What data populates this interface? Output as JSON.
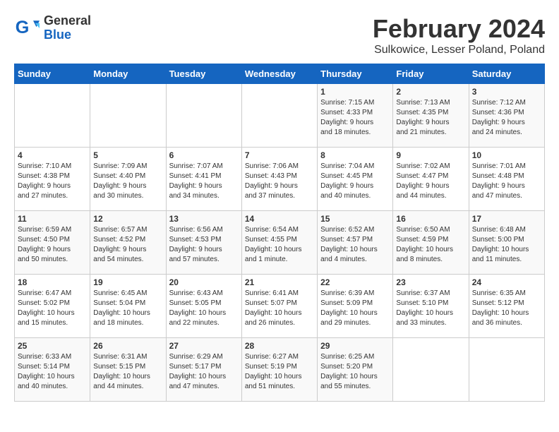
{
  "logo": {
    "text_general": "General",
    "text_blue": "Blue"
  },
  "title": "February 2024",
  "subtitle": "Sulkowice, Lesser Poland, Poland",
  "days_of_week": [
    "Sunday",
    "Monday",
    "Tuesday",
    "Wednesday",
    "Thursday",
    "Friday",
    "Saturday"
  ],
  "weeks": [
    [
      {
        "day": "",
        "info": ""
      },
      {
        "day": "",
        "info": ""
      },
      {
        "day": "",
        "info": ""
      },
      {
        "day": "",
        "info": ""
      },
      {
        "day": "1",
        "info": "Sunrise: 7:15 AM\nSunset: 4:33 PM\nDaylight: 9 hours\nand 18 minutes."
      },
      {
        "day": "2",
        "info": "Sunrise: 7:13 AM\nSunset: 4:35 PM\nDaylight: 9 hours\nand 21 minutes."
      },
      {
        "day": "3",
        "info": "Sunrise: 7:12 AM\nSunset: 4:36 PM\nDaylight: 9 hours\nand 24 minutes."
      }
    ],
    [
      {
        "day": "4",
        "info": "Sunrise: 7:10 AM\nSunset: 4:38 PM\nDaylight: 9 hours\nand 27 minutes."
      },
      {
        "day": "5",
        "info": "Sunrise: 7:09 AM\nSunset: 4:40 PM\nDaylight: 9 hours\nand 30 minutes."
      },
      {
        "day": "6",
        "info": "Sunrise: 7:07 AM\nSunset: 4:41 PM\nDaylight: 9 hours\nand 34 minutes."
      },
      {
        "day": "7",
        "info": "Sunrise: 7:06 AM\nSunset: 4:43 PM\nDaylight: 9 hours\nand 37 minutes."
      },
      {
        "day": "8",
        "info": "Sunrise: 7:04 AM\nSunset: 4:45 PM\nDaylight: 9 hours\nand 40 minutes."
      },
      {
        "day": "9",
        "info": "Sunrise: 7:02 AM\nSunset: 4:47 PM\nDaylight: 9 hours\nand 44 minutes."
      },
      {
        "day": "10",
        "info": "Sunrise: 7:01 AM\nSunset: 4:48 PM\nDaylight: 9 hours\nand 47 minutes."
      }
    ],
    [
      {
        "day": "11",
        "info": "Sunrise: 6:59 AM\nSunset: 4:50 PM\nDaylight: 9 hours\nand 50 minutes."
      },
      {
        "day": "12",
        "info": "Sunrise: 6:57 AM\nSunset: 4:52 PM\nDaylight: 9 hours\nand 54 minutes."
      },
      {
        "day": "13",
        "info": "Sunrise: 6:56 AM\nSunset: 4:53 PM\nDaylight: 9 hours\nand 57 minutes."
      },
      {
        "day": "14",
        "info": "Sunrise: 6:54 AM\nSunset: 4:55 PM\nDaylight: 10 hours\nand 1 minute."
      },
      {
        "day": "15",
        "info": "Sunrise: 6:52 AM\nSunset: 4:57 PM\nDaylight: 10 hours\nand 4 minutes."
      },
      {
        "day": "16",
        "info": "Sunrise: 6:50 AM\nSunset: 4:59 PM\nDaylight: 10 hours\nand 8 minutes."
      },
      {
        "day": "17",
        "info": "Sunrise: 6:48 AM\nSunset: 5:00 PM\nDaylight: 10 hours\nand 11 minutes."
      }
    ],
    [
      {
        "day": "18",
        "info": "Sunrise: 6:47 AM\nSunset: 5:02 PM\nDaylight: 10 hours\nand 15 minutes."
      },
      {
        "day": "19",
        "info": "Sunrise: 6:45 AM\nSunset: 5:04 PM\nDaylight: 10 hours\nand 18 minutes."
      },
      {
        "day": "20",
        "info": "Sunrise: 6:43 AM\nSunset: 5:05 PM\nDaylight: 10 hours\nand 22 minutes."
      },
      {
        "day": "21",
        "info": "Sunrise: 6:41 AM\nSunset: 5:07 PM\nDaylight: 10 hours\nand 26 minutes."
      },
      {
        "day": "22",
        "info": "Sunrise: 6:39 AM\nSunset: 5:09 PM\nDaylight: 10 hours\nand 29 minutes."
      },
      {
        "day": "23",
        "info": "Sunrise: 6:37 AM\nSunset: 5:10 PM\nDaylight: 10 hours\nand 33 minutes."
      },
      {
        "day": "24",
        "info": "Sunrise: 6:35 AM\nSunset: 5:12 PM\nDaylight: 10 hours\nand 36 minutes."
      }
    ],
    [
      {
        "day": "25",
        "info": "Sunrise: 6:33 AM\nSunset: 5:14 PM\nDaylight: 10 hours\nand 40 minutes."
      },
      {
        "day": "26",
        "info": "Sunrise: 6:31 AM\nSunset: 5:15 PM\nDaylight: 10 hours\nand 44 minutes."
      },
      {
        "day": "27",
        "info": "Sunrise: 6:29 AM\nSunset: 5:17 PM\nDaylight: 10 hours\nand 47 minutes."
      },
      {
        "day": "28",
        "info": "Sunrise: 6:27 AM\nSunset: 5:19 PM\nDaylight: 10 hours\nand 51 minutes."
      },
      {
        "day": "29",
        "info": "Sunrise: 6:25 AM\nSunset: 5:20 PM\nDaylight: 10 hours\nand 55 minutes."
      },
      {
        "day": "",
        "info": ""
      },
      {
        "day": "",
        "info": ""
      }
    ]
  ]
}
